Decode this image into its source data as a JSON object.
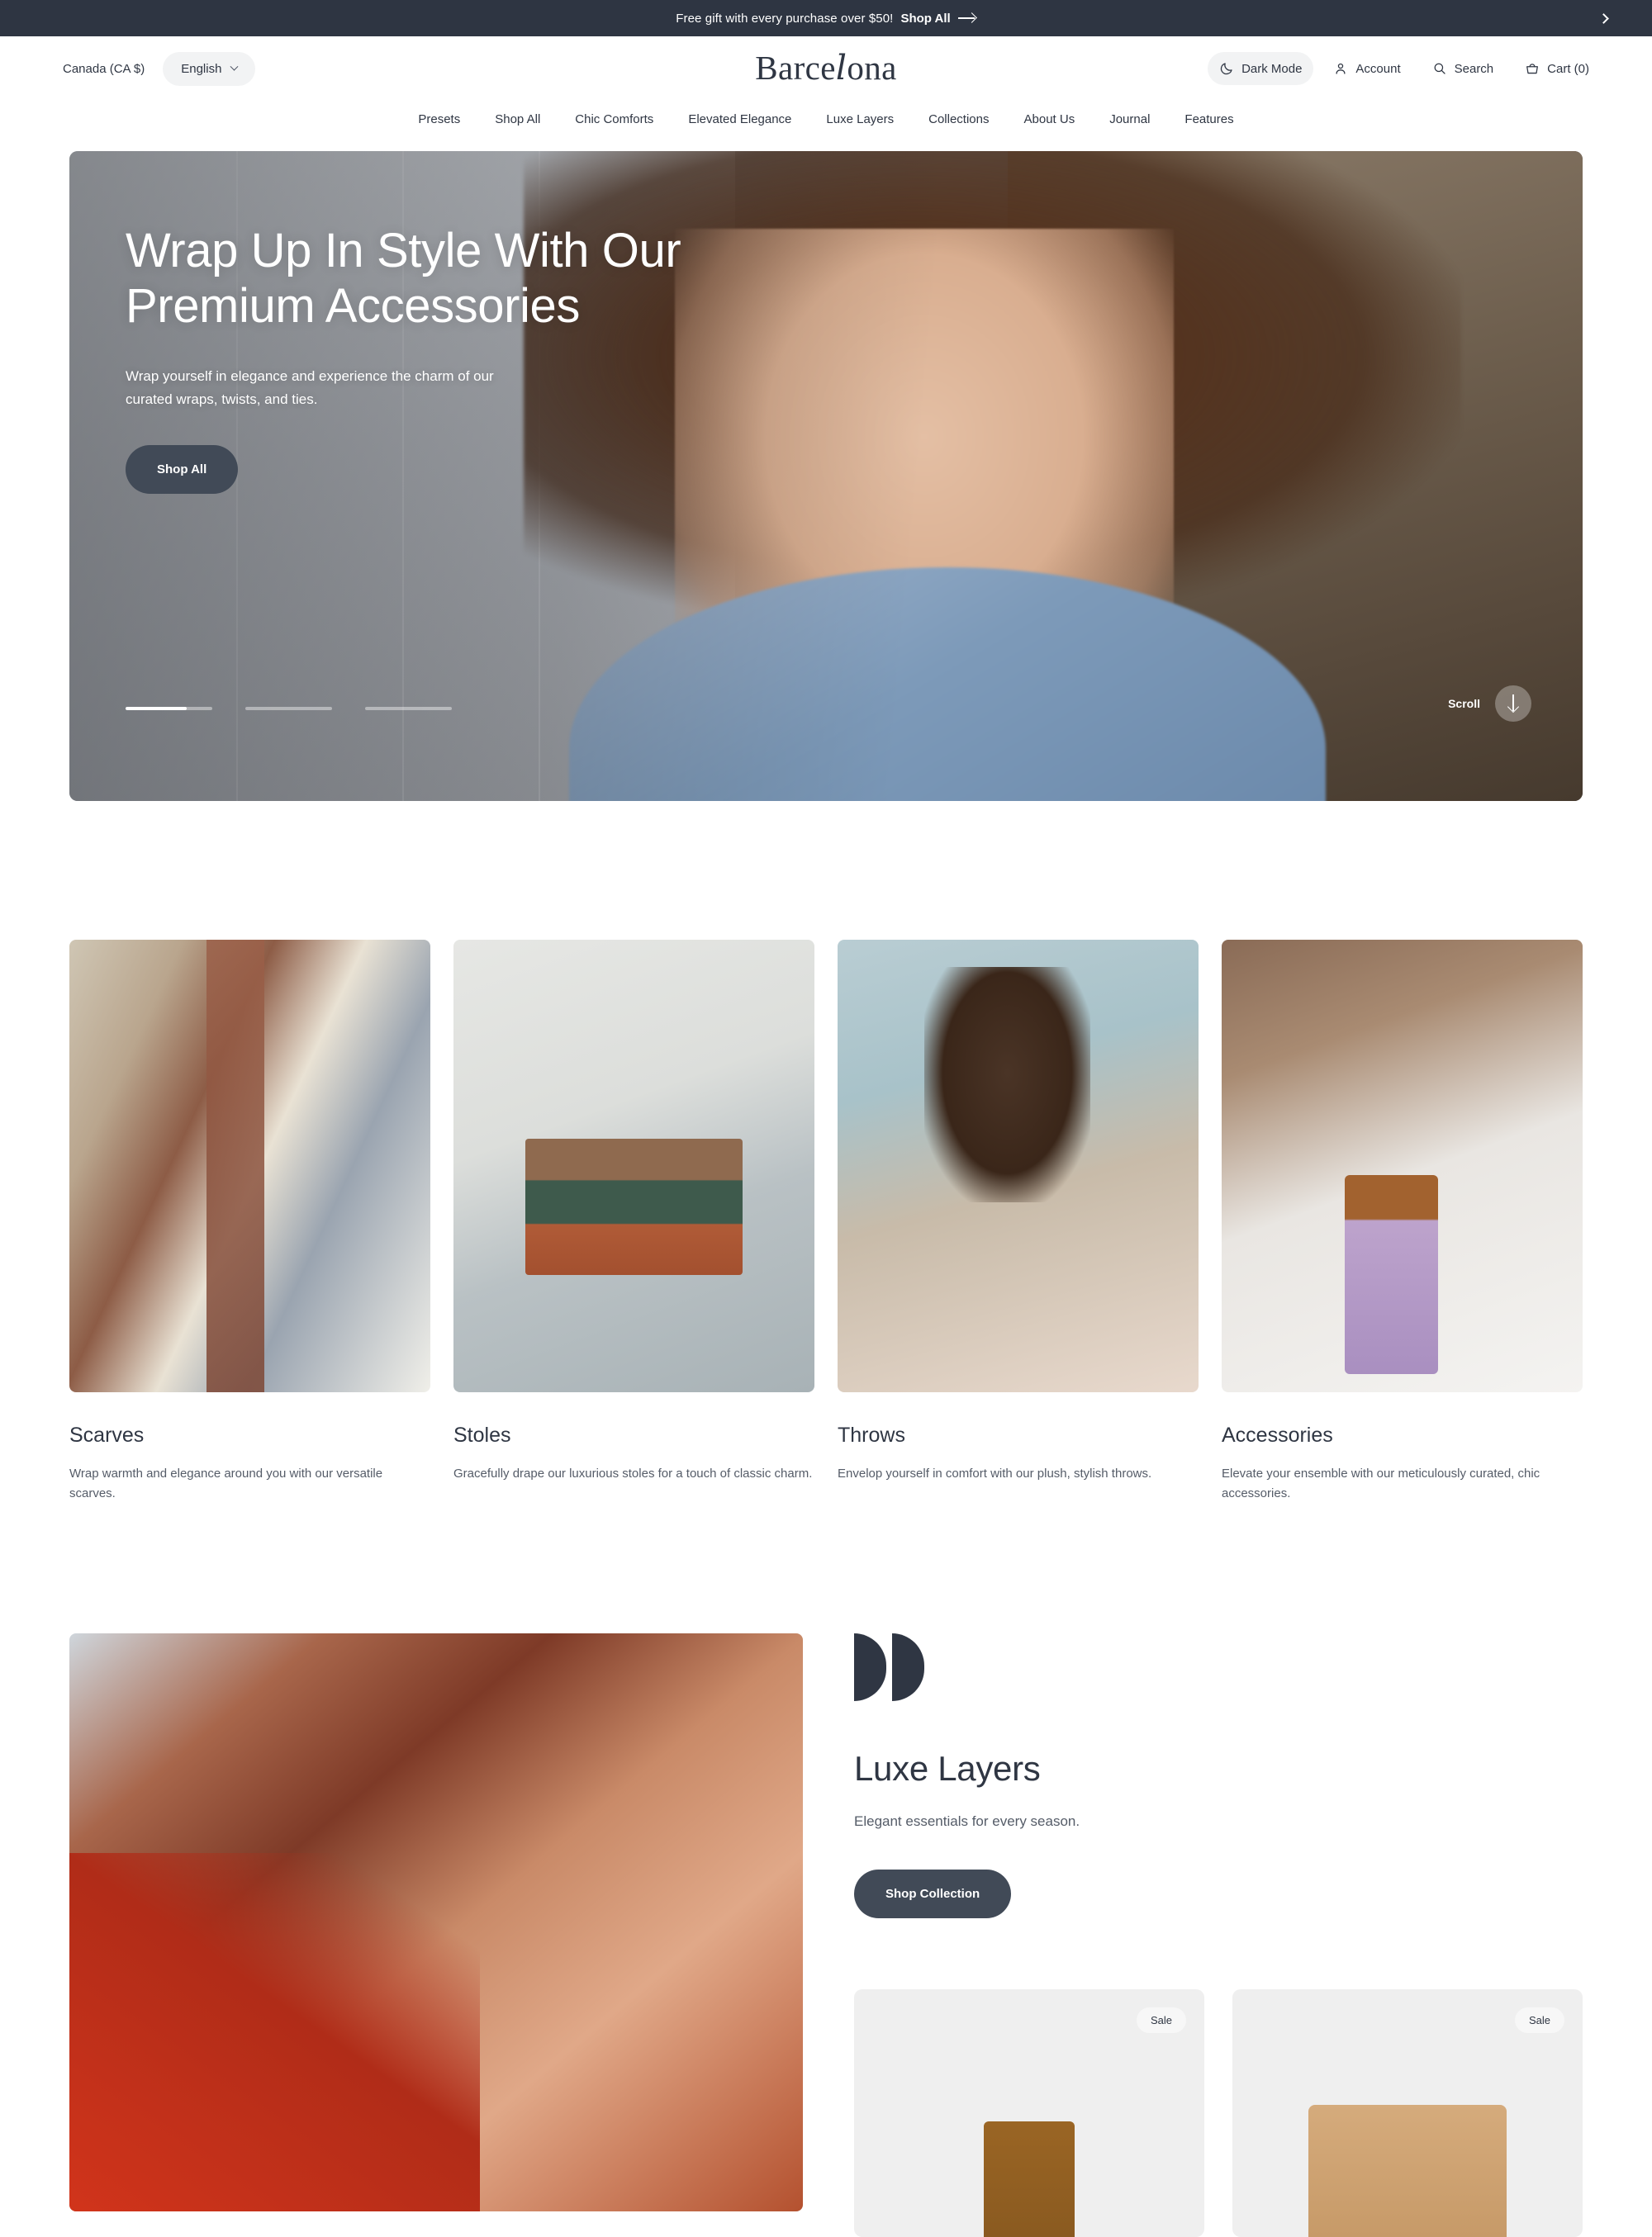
{
  "announcement": {
    "text": "Free gift with every purchase over $50!",
    "link_label": "Shop All",
    "next_label": "Next announcement"
  },
  "header": {
    "currency": "Canada (CA $)",
    "language": "English",
    "logo": {
      "part1": "Barce",
      "swash": "l",
      "part2": "ona"
    },
    "utilities": [
      {
        "label": "Dark Mode",
        "icon": "moon-icon"
      },
      {
        "label": "Account",
        "icon": "user-icon"
      },
      {
        "label": "Search",
        "icon": "search-icon"
      },
      {
        "label": "Cart (0)",
        "icon": "cart-icon"
      }
    ]
  },
  "nav": {
    "items": [
      "Presets",
      "Shop All",
      "Chic Comforts",
      "Elevated Elegance",
      "Luxe Layers",
      "Collections",
      "About Us",
      "Journal",
      "Features"
    ]
  },
  "hero": {
    "heading": "Wrap Up In Style With Our Premium Accessories",
    "subheading": "Wrap yourself in elegance and experience the charm of our curated wraps, twists, and ties.",
    "cta_label": "Shop All",
    "scroll_label": "Scroll",
    "slides": [
      {
        "progress": 70
      },
      {
        "progress": 0
      },
      {
        "progress": 0
      }
    ]
  },
  "categories": [
    {
      "title": "Scarves",
      "description": "Wrap warmth and elegance around you with our versatile scarves."
    },
    {
      "title": "Stoles",
      "description": "Gracefully drape our luxurious stoles for a touch of classic charm."
    },
    {
      "title": "Throws",
      "description": "Envelop yourself in comfort with our plush, stylish throws."
    },
    {
      "title": "Accessories",
      "description": "Elevate your ensemble with our meticulously curated, chic accessories."
    }
  ],
  "feature": {
    "title": "Luxe Layers",
    "subtitle": "Elegant essentials for every season.",
    "cta_label": "Shop Collection",
    "products": [
      {
        "badge": "Sale"
      },
      {
        "badge": "Sale"
      }
    ]
  },
  "colors": {
    "dark": "#2e3542",
    "button": "#414a57",
    "pill": "#f2f3f4",
    "card": "#efefef",
    "body_text": "#555c68"
  }
}
